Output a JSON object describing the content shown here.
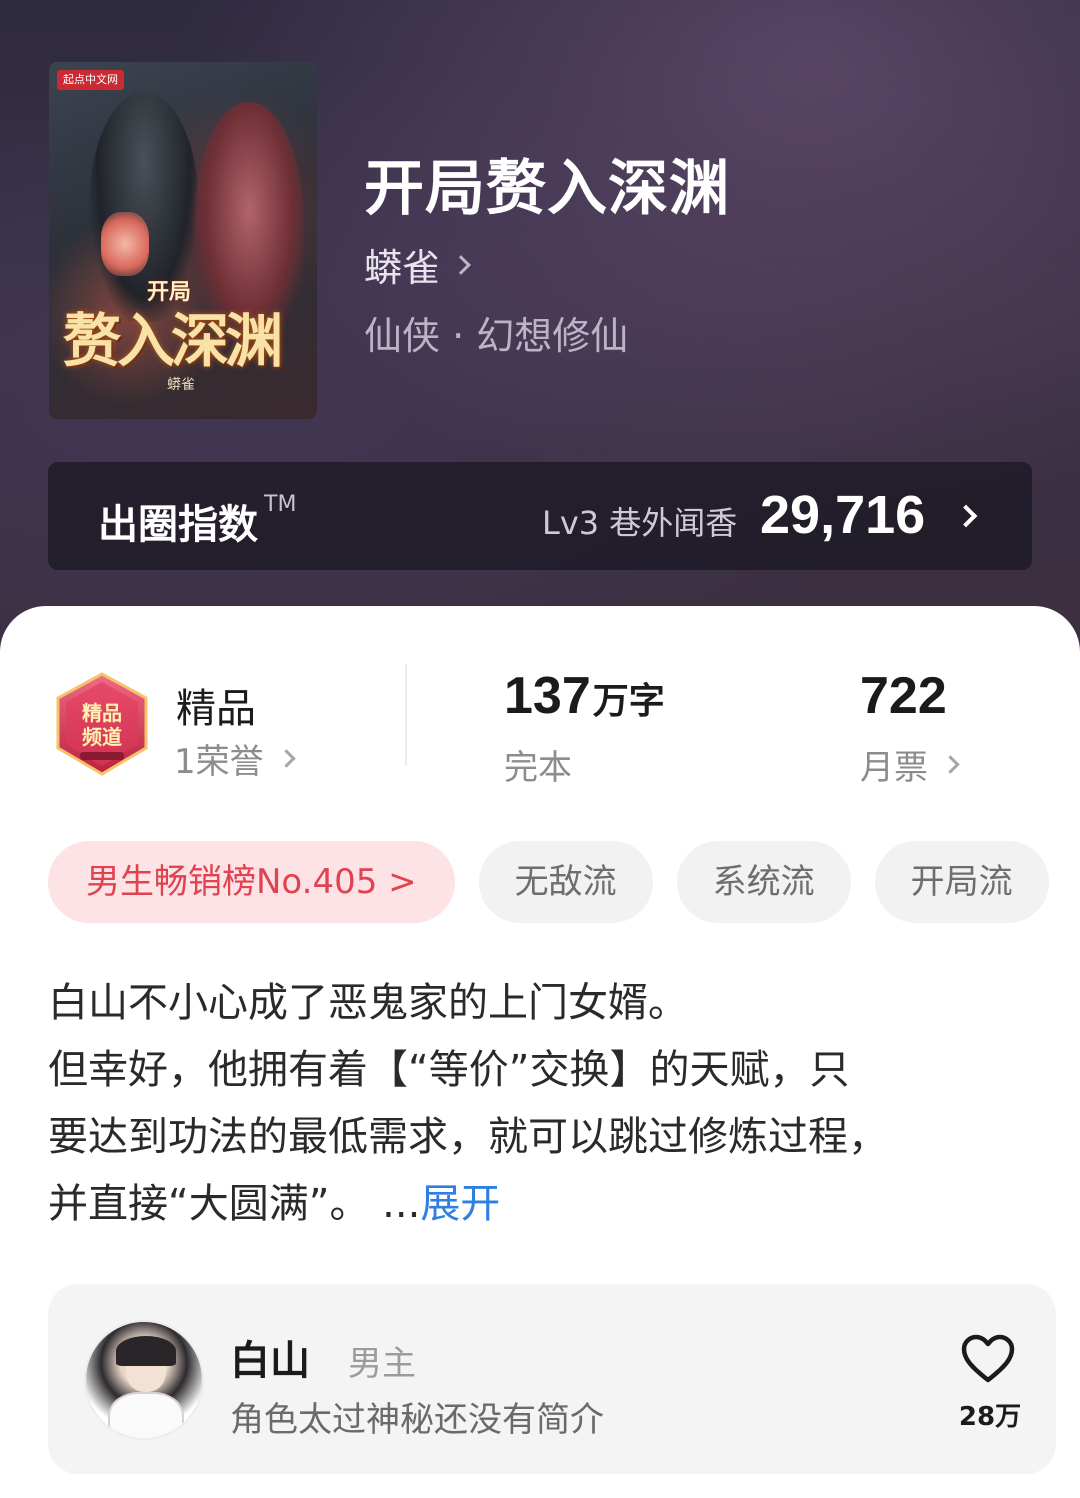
{
  "book": {
    "cover_publisher": "起点中文网",
    "cover_title_small": "开局",
    "cover_title_main": "赘入深渊",
    "cover_author": "蟒雀",
    "title": "开局赘入深渊",
    "author": "蟒雀",
    "genre": "仙侠 · 幻想修仙"
  },
  "index": {
    "label": "出圈指数",
    "tm": "TM",
    "level": "Lv3 巷外闻香",
    "value": "29,716"
  },
  "stats": {
    "badge_icon": "jingpin-pindao-badge-icon",
    "badge_title": "精品",
    "badge_sub": "1荣誉",
    "words_num": "137",
    "words_unit": "万字",
    "words_sub": "完本",
    "tickets_num": "722",
    "tickets_sub": "月票"
  },
  "tags": {
    "rank": "男生畅销榜No.405 >",
    "tag1": "无敌流",
    "tag2": "系统流",
    "tag3": "开局流"
  },
  "synopsis": {
    "line1": "白山不小心成了恶鬼家的上门女婿。",
    "line2": "但幸好，他拥有着【“等价”交换】的天赋，只",
    "line3": "要达到功法的最低需求，就可以跳过修炼过程，",
    "line4": "并直接“大圆满”。 ...",
    "expand": "展开"
  },
  "role": {
    "name": "白山",
    "type": "男主",
    "desc": "角色太过神秘还没有简介",
    "likes": "28万"
  },
  "colors": {
    "accent_blue": "#2f7fe0",
    "rank_red": "#e0434f",
    "rank_bg": "#fde3e5"
  }
}
